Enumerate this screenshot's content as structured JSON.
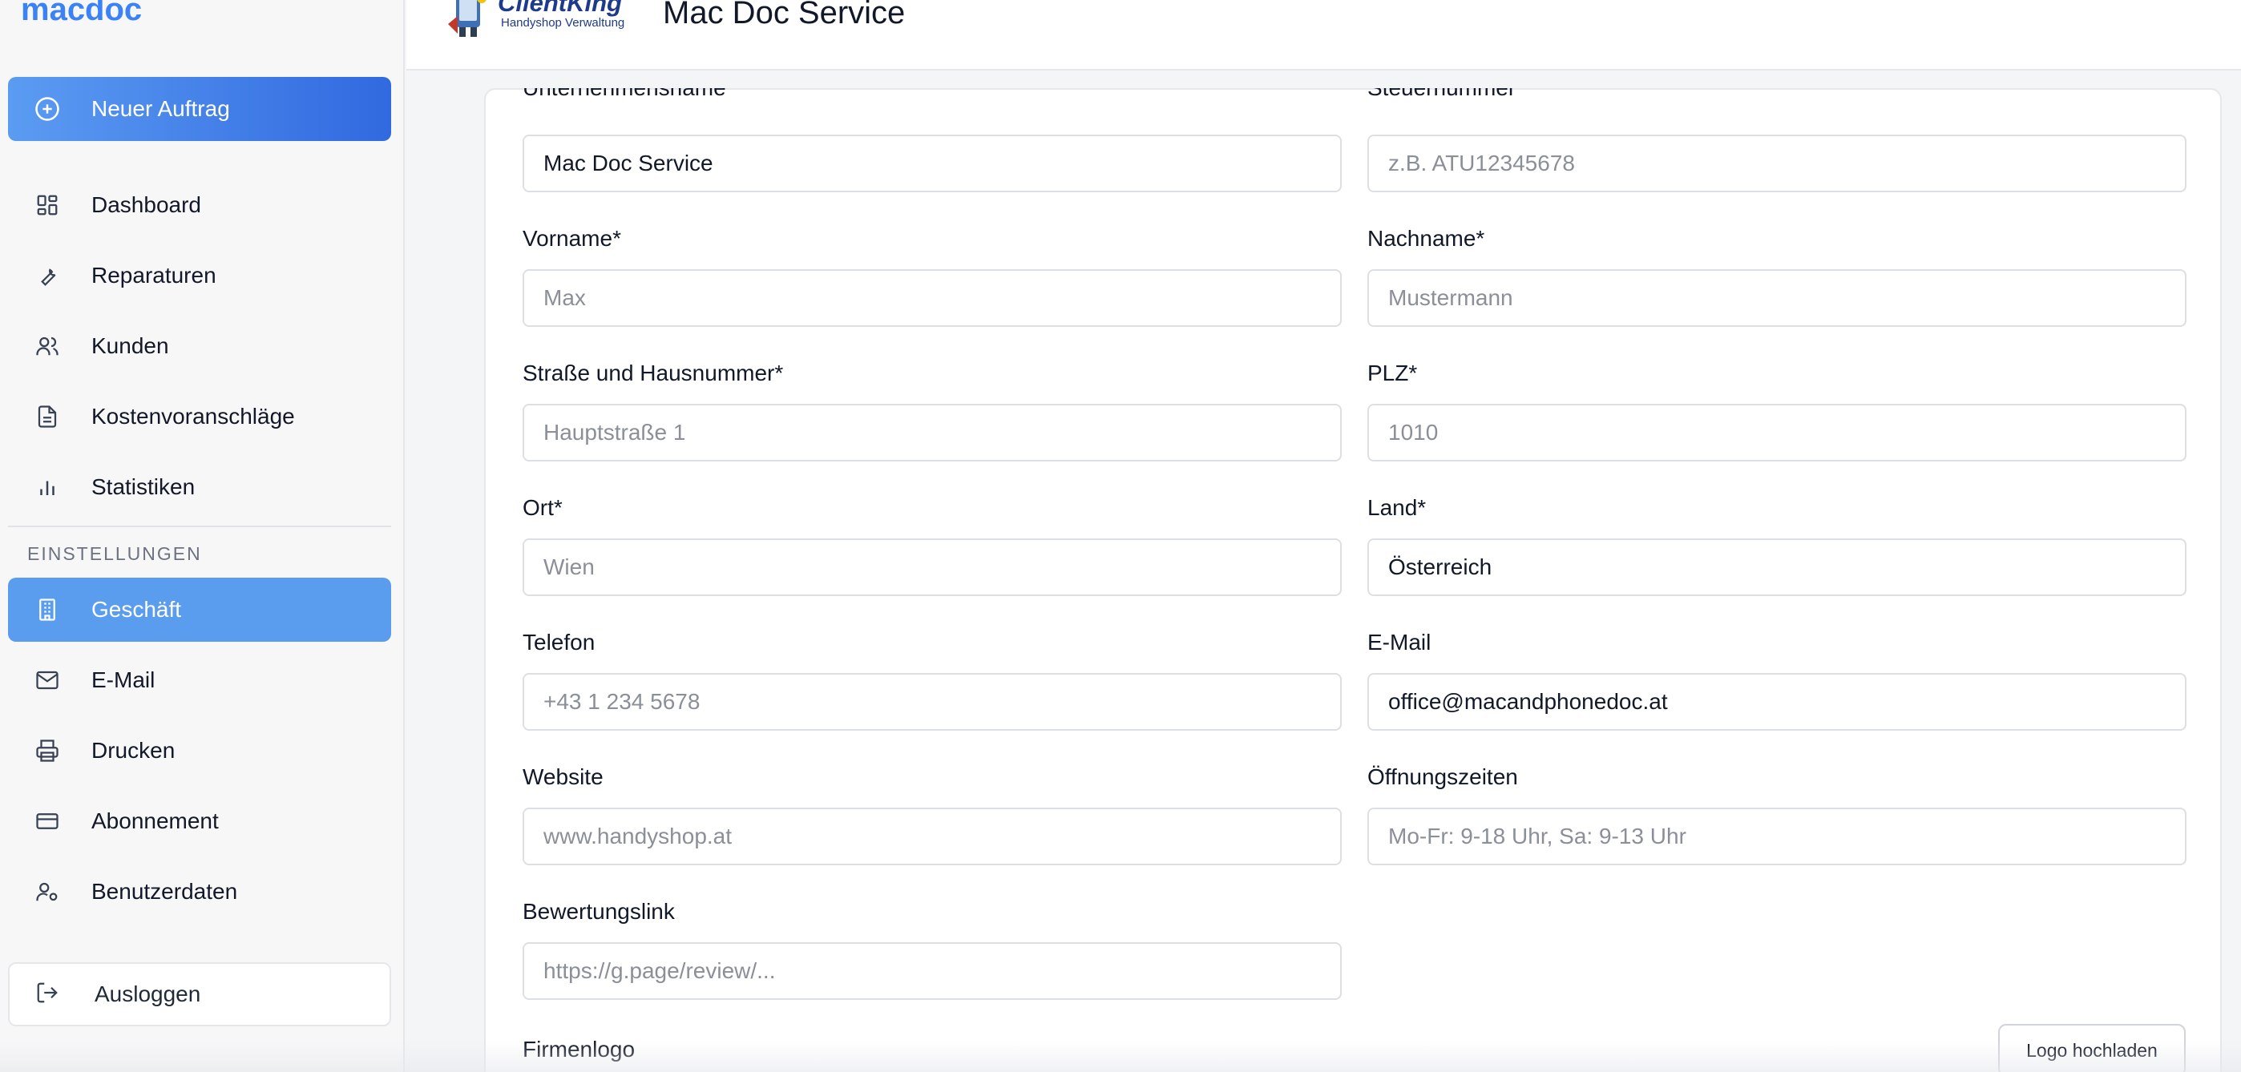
{
  "brand": "macdoc",
  "sidebar": {
    "new_order_label": "Neuer Auftrag",
    "items": [
      {
        "label": "Dashboard"
      },
      {
        "label": "Reparaturen"
      },
      {
        "label": "Kunden"
      },
      {
        "label": "Kostenvoranschläge"
      },
      {
        "label": "Statistiken"
      }
    ],
    "settings_label": "EINSTELLUNGEN",
    "settings_items": [
      {
        "label": "Geschäft"
      },
      {
        "label": "E-Mail"
      },
      {
        "label": "Drucken"
      },
      {
        "label": "Abonnement"
      },
      {
        "label": "Benutzerdaten"
      }
    ],
    "logout_label": "Ausloggen"
  },
  "header": {
    "logo_title": "ClientKing",
    "logo_subtitle": "Handyshop Verwaltung",
    "title": "Mac Doc Service"
  },
  "form": {
    "company_label": "Unternehmensname",
    "company_value": "Mac Doc Service",
    "tax_label": "Steuernummer",
    "tax_placeholder": "z.B. ATU12345678",
    "firstname_label": "Vorname*",
    "firstname_placeholder": "Max",
    "lastname_label": "Nachname*",
    "lastname_placeholder": "Mustermann",
    "street_label": "Straße und Hausnummer*",
    "street_placeholder": "Hauptstraße 1",
    "zip_label": "PLZ*",
    "zip_placeholder": "1010",
    "city_label": "Ort*",
    "city_placeholder": "Wien",
    "country_label": "Land*",
    "country_value": "Österreich",
    "phone_label": "Telefon",
    "phone_placeholder": "+43 1 234 5678",
    "email_label": "E-Mail",
    "email_value": "office@macandphonedoc.at",
    "website_label": "Website",
    "website_placeholder": "www.handyshop.at",
    "hours_label": "Öffnungszeiten",
    "hours_placeholder": "Mo-Fr: 9-18 Uhr, Sa: 9-13 Uhr",
    "review_label": "Bewertungslink",
    "review_placeholder": "https://g.page/review/...",
    "logo_label": "Firmenlogo",
    "upload_label": "Logo hochladen"
  },
  "colors": {
    "accent": "#3b82f6",
    "active_item": "#5a9cee"
  }
}
